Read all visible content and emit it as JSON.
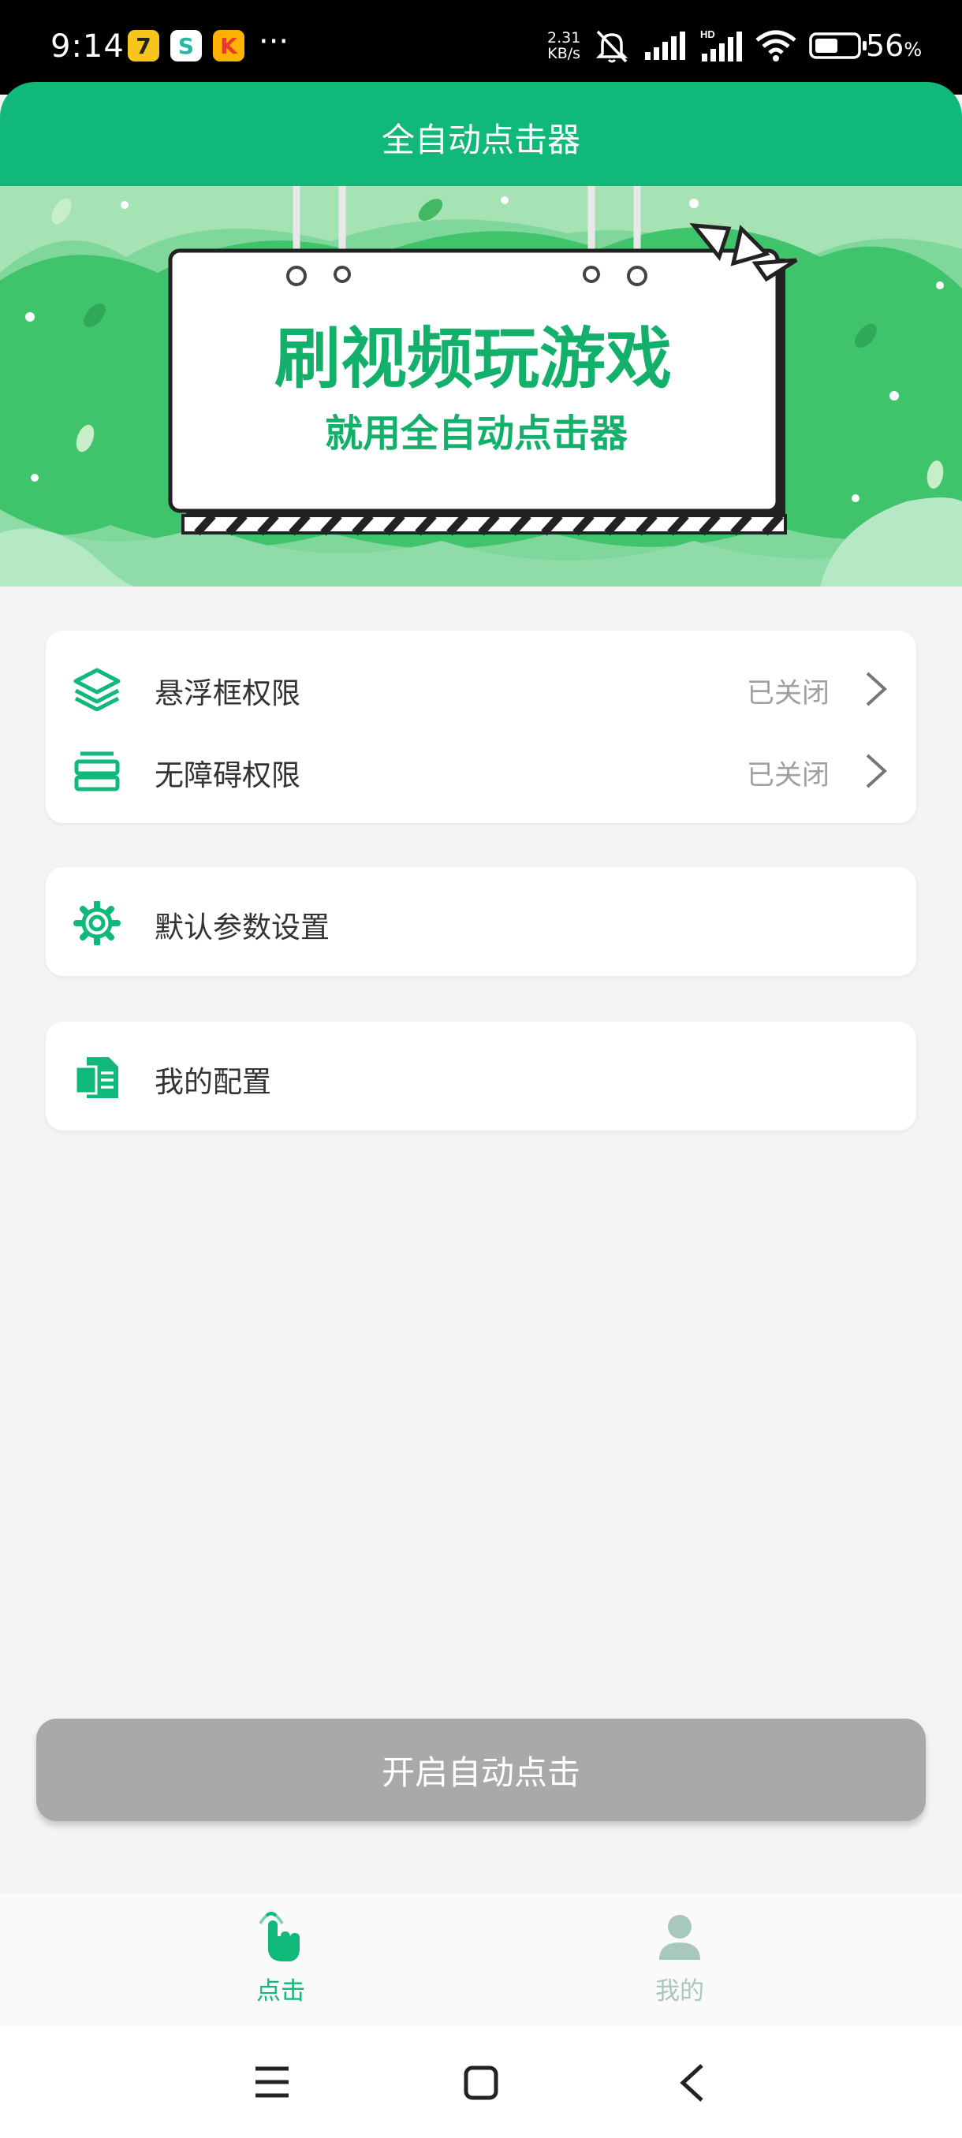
{
  "status_bar": {
    "time": "9:14",
    "app_icons": [
      {
        "glyph": "7",
        "bg": "#f7c51b",
        "fg": "#222"
      },
      {
        "glyph": "S",
        "bg": "#ffffff",
        "fg": "#25b8a8"
      },
      {
        "glyph": "K",
        "bg": "#ffb300",
        "fg": "#e8392d"
      }
    ],
    "more": "···",
    "net_speed_value": "2.31",
    "net_speed_unit": "KB/s",
    "battery_percent": "56",
    "battery_sign": "%",
    "battery_level": 0.56
  },
  "header": {
    "title": "全自动点击器"
  },
  "banner": {
    "headline": "刷视频玩游戏",
    "subline": "就用全自动点击器"
  },
  "permissions": [
    {
      "label": "悬浮框权限",
      "status": "已关闭",
      "icon": "layers-icon"
    },
    {
      "label": "无障碍权限",
      "status": "已关闭",
      "icon": "accessibility-stack-icon"
    }
  ],
  "settings_item": {
    "label": "默认参数设置",
    "icon": "gear-icon"
  },
  "config_item": {
    "label": "我的配置",
    "icon": "document-icon"
  },
  "start_button": {
    "label": "开启自动点击"
  },
  "bottom_nav": {
    "items": [
      {
        "label": "点击",
        "active": true,
        "icon": "tap-hand-icon"
      },
      {
        "label": "我的",
        "active": false,
        "icon": "user-icon"
      }
    ]
  },
  "colors": {
    "brand": "#10b97a",
    "inactive": "#a8c8bc",
    "button_disabled": "#a9a9a9"
  }
}
